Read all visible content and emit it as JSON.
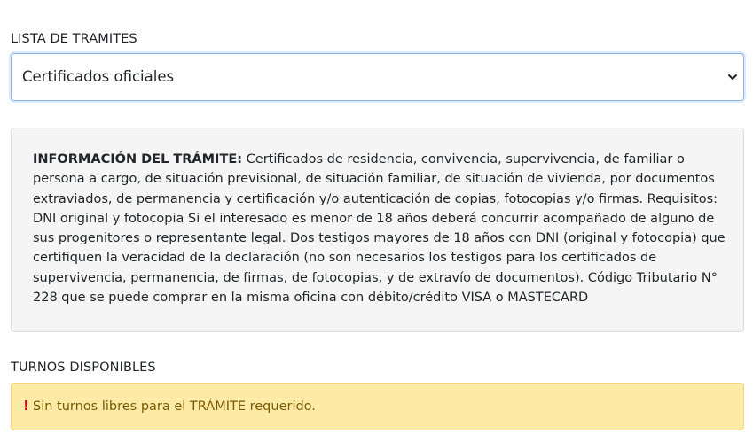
{
  "tramites": {
    "label": "LISTA DE TRAMITES",
    "selected": "Certificados oficiales"
  },
  "info": {
    "heading": "INFORMACIÓN DEL TRÁMITE:",
    "body": " Certificados de residencia, convivencia, supervivencia, de familiar o persona a cargo, de situación previsional, de situación familiar, de situación de vivienda, por documentos extraviados, de permanencia y certificación y/o autenticación de copias, fotocopias y/o firmas. Requisitos: DNI original y fotocopia Si el interesado es menor de 18 años deberá concurrir acompañado de alguno de sus progenitores o representante legal. Dos testigos mayores de 18 años con DNI (original y fotocopia) que certifiquen la veracidad de la declaración (no son necesarios los testigos para los certificados de supervivencia, permanencia, de firmas, de fotocopias, y de extravío de documentos). Código Tributario N° 228 que se puede comprar en la misma oficina con débito/crédito VISA o MASTECARD"
  },
  "turnos": {
    "label": "TURNOS DISPONIBLES",
    "alert_icon": "!",
    "alert_text": "Sin turnos libres para el TRÁMITE requerido."
  },
  "colors": {
    "select_border": "#8fb8e8",
    "info_bg": "#f5f5f5",
    "alert_bg": "#fdeaa7",
    "alert_icon": "#d6001c"
  },
  "icons": {
    "select": "chevron-down-icon",
    "alert": "exclamation-icon"
  }
}
